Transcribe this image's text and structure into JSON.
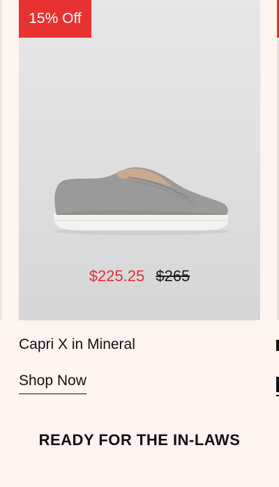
{
  "product": {
    "badge": "15% Off",
    "sale_price": "$225.25",
    "original_price": "$265",
    "title": "Capri X in Mineral",
    "cta": "Shop Now",
    "image_icon": "sneaker-image"
  },
  "section": {
    "heading": "READY FOR THE IN-LAWS"
  },
  "colors": {
    "badge": "#e83232",
    "sale_price": "#e2302f",
    "background": "#fdf3ef"
  }
}
